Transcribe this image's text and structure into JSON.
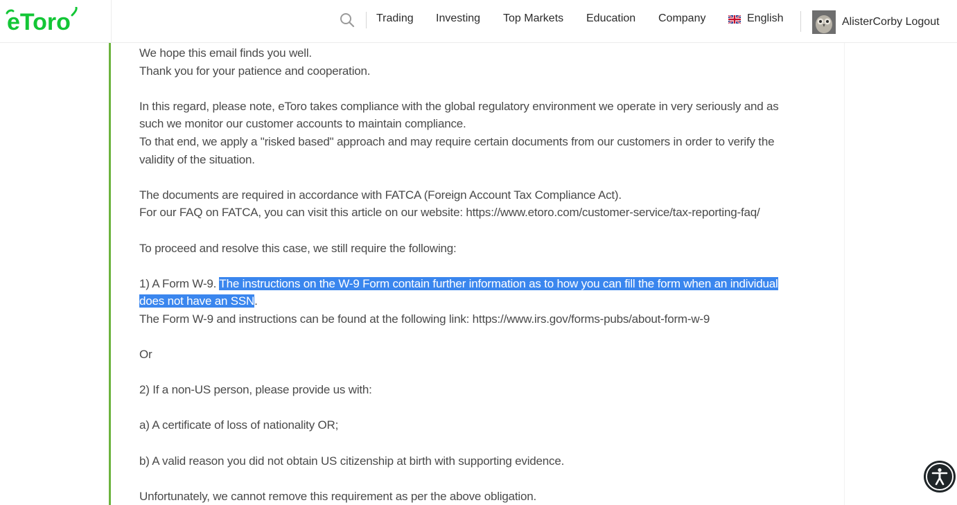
{
  "header": {
    "logo_text": "eToro",
    "nav": [
      "Trading",
      "Investing",
      "Top Markets",
      "Education",
      "Company"
    ],
    "language": "English",
    "username": "AlisterCorby",
    "logout_label": "Logout"
  },
  "email": {
    "greeting": "We hope this email finds you well.",
    "thanks": "Thank you for your patience and cooperation.",
    "p1_l1": "In this regard, please note, eToro takes compliance with the global regulatory environment we operate in very seriously and as",
    "p1_l2": "such we monitor our customer accounts to maintain compliance.",
    "p1_l3": "To that end, we apply a \"risked based\" approach and may require certain documents from our customers in order to verify the",
    "p1_l4": "validity of the situation.",
    "p2_l1": "The documents are required in accordance with FATCA (Foreign Account Tax Compliance Act).",
    "p2_l2": "For our FAQ on FATCA, you can visit this article on our website: https://www.etoro.com/customer-service/tax-reporting-faq/",
    "p3": "To proceed and resolve this case, we still require the following:",
    "item1_prefix": "1) A Form W-9. ",
    "item1_hl1": "The instructions on the W-9 Form contain further information as to how you can fill the form when an individual ",
    "item1_hl2": "does not have an SSN",
    "item1_suffix": ".",
    "item1_link": "The Form W-9 and instructions can be found at the following link: https://www.irs.gov/forms-pubs/about-form-w-9",
    "or": "Or",
    "item2": "2) If a non-US person, please provide us with:",
    "item2a": "a) A certificate of loss of nationality OR;",
    "item2b": "b) A valid reason you did not obtain US citizenship at birth with supporting evidence.",
    "closing": "Unfortunately, we cannot remove this requirement as per the above obligation."
  },
  "colors": {
    "brand_green": "#13c636",
    "accent_bar": "#6cb33e",
    "highlight": "#3a86ee"
  }
}
